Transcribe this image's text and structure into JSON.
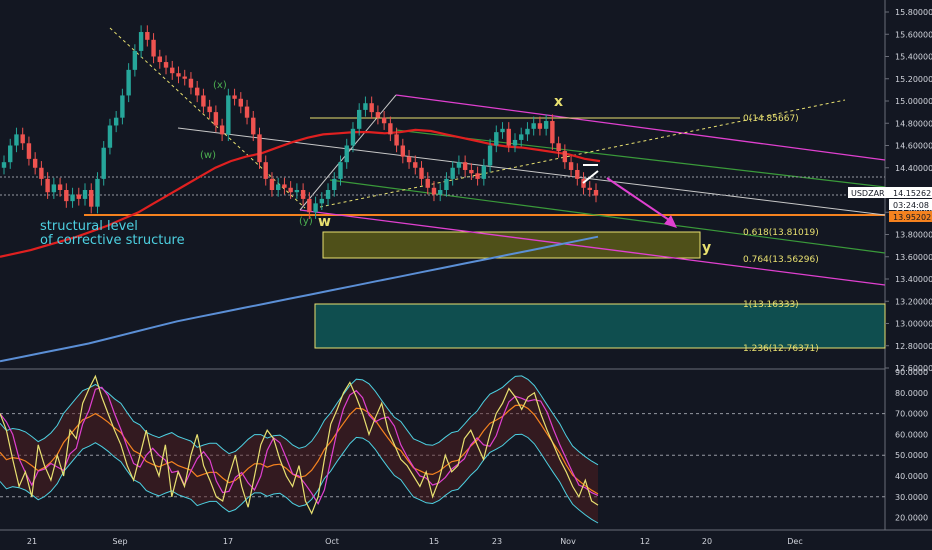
{
  "chart_data": [
    {
      "type": "line",
      "symbol": "USDZAR",
      "price_label": "14.15262",
      "countdown_label": "03:24:08",
      "level_label": "13.95202",
      "y_ticks": [
        "15.80000",
        "15.60000",
        "15.40000",
        "15.20000",
        "15.00000",
        "14.80000",
        "14.60000",
        "14.40000",
        "14.20000",
        "14.00000",
        "13.80000",
        "13.60000",
        "13.40000",
        "13.20000",
        "13.00000",
        "12.80000",
        "12.60000"
      ],
      "ylim": [
        12.6,
        15.8
      ],
      "x_ticks": [
        "21",
        "Sep",
        "17",
        "Oct",
        "15",
        "23",
        "Nov",
        "12",
        "20",
        "Dec"
      ],
      "price_series": [
        14.45,
        14.6,
        14.7,
        14.62,
        14.48,
        14.4,
        14.3,
        14.18,
        14.25,
        14.2,
        14.1,
        14.16,
        14.12,
        14.2,
        14.05,
        14.3,
        14.58,
        14.78,
        14.85,
        15.05,
        15.28,
        15.45,
        15.62,
        15.55,
        15.4,
        15.35,
        15.3,
        15.25,
        15.22,
        15.2,
        15.12,
        15.05,
        14.95,
        14.9,
        14.78,
        14.7,
        15.05,
        15.02,
        14.95,
        14.85,
        14.7,
        14.45,
        14.3,
        14.2,
        14.25,
        14.22,
        14.18,
        14.2,
        14.12,
        14.0,
        14.08,
        14.12,
        14.2,
        14.3,
        14.45,
        14.6,
        14.75,
        14.92,
        14.98,
        14.9,
        14.85,
        14.8,
        14.7,
        14.6,
        14.5,
        14.45,
        14.4,
        14.3,
        14.22,
        14.16,
        14.2,
        14.3,
        14.4,
        14.45,
        14.38,
        14.35,
        14.3,
        14.42,
        14.6,
        14.72,
        14.75,
        14.6,
        14.65,
        14.7,
        14.75,
        14.8,
        14.75,
        14.82,
        14.62,
        14.55,
        14.45,
        14.38,
        14.3,
        14.22,
        14.2,
        14.15
      ],
      "ema_red": [
        13.6,
        13.63,
        13.66,
        13.7,
        13.74,
        13.78,
        13.83,
        13.88,
        13.94,
        14.0,
        14.08,
        14.16,
        14.24,
        14.32,
        14.4,
        14.46,
        14.5,
        14.53,
        14.58,
        14.63,
        14.67,
        14.7,
        14.71,
        14.72,
        14.72,
        14.71,
        14.72,
        14.74,
        14.73,
        14.7,
        14.67,
        14.64,
        14.61,
        14.59,
        14.58,
        14.56,
        14.54,
        14.52,
        14.48,
        14.46
      ],
      "ma_blue": [
        12.66,
        12.7,
        12.74,
        12.78,
        12.82,
        12.87,
        12.92,
        12.97,
        13.02,
        13.06,
        13.1,
        13.14,
        13.18,
        13.22,
        13.26,
        13.3,
        13.34,
        13.38,
        13.42,
        13.46,
        13.5,
        13.54,
        13.58,
        13.62,
        13.66,
        13.7,
        13.74,
        13.78
      ],
      "annotations": [
        "structural level",
        "of corrective structure",
        "(x)",
        "(w)",
        "(y)",
        "w",
        "x",
        "y"
      ],
      "fib_levels": [
        {
          "label": "0(14.85667)",
          "value": 14.85667
        },
        {
          "label": "0.618(13.81019)",
          "value": 13.81019
        },
        {
          "label": "0.764(13.56296)",
          "value": 13.56296
        },
        {
          "label": "1(13.16333)",
          "value": 13.16333
        },
        {
          "label": "1.236(12.76371)",
          "value": 12.76371
        }
      ],
      "colors": {
        "background": "#131722",
        "bull": "#26a69a",
        "bear": "#ef5350",
        "ema": "#e02020",
        "ma": "#5b8fd6",
        "channel": "#e040d0",
        "green_channel": "#3a9a3a",
        "fib": "#e8e070",
        "level": "#f5821f",
        "annotation_cyan": "#4dd0e1",
        "annotation_yellow": "#e8e070",
        "annotation_green": "#4caf50"
      }
    },
    {
      "type": "line",
      "panel": "oscillator",
      "y_ticks": [
        "90.0000",
        "80.0000",
        "70.0000",
        "60.0000",
        "50.0000",
        "40.0000",
        "30.0000",
        "20.0000"
      ],
      "ylim": [
        15,
        90
      ],
      "reference_lines": [
        70,
        50,
        30
      ],
      "oscillator_series": [
        70,
        62,
        48,
        35,
        42,
        30,
        55,
        45,
        38,
        50,
        40,
        62,
        58,
        75,
        82,
        88,
        78,
        70,
        62,
        55,
        45,
        38,
        50,
        62,
        48,
        40,
        55,
        30,
        42,
        35,
        50,
        60,
        45,
        38,
        30,
        28,
        40,
        50,
        35,
        25,
        40,
        55,
        62,
        58,
        48,
        40,
        35,
        45,
        28,
        22,
        30,
        48,
        65,
        72,
        80,
        85,
        78,
        70,
        60,
        68,
        75,
        62,
        55,
        48,
        45,
        40,
        35,
        42,
        30,
        38,
        50,
        42,
        45,
        58,
        62,
        55,
        48,
        60,
        70,
        75,
        82,
        78,
        72,
        78,
        80,
        70,
        62,
        55,
        48,
        42,
        35,
        30,
        38,
        28,
        26
      ]
    }
  ]
}
